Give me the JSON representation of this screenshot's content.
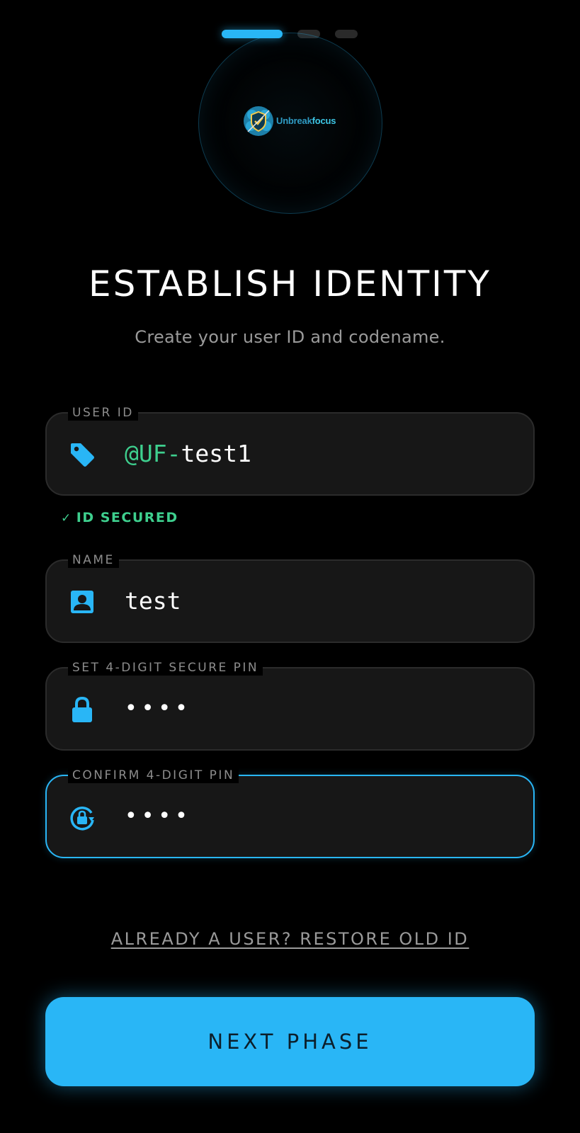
{
  "stepper": {
    "total": 3,
    "current": 1
  },
  "logo": {
    "name_part_a": "Unbreak",
    "name_part_b": "focus"
  },
  "header": {
    "title": "ESTABLISH IDENTITY",
    "subtitle": "Create your user ID and codename."
  },
  "fields": {
    "user_id": {
      "label": "USER ID",
      "prefix": "@UF-",
      "value": "test1",
      "icon": "tag-icon"
    },
    "user_id_status": {
      "text": "ID SECURED",
      "icon": "check-icon"
    },
    "name": {
      "label": "NAME",
      "value": "test",
      "icon": "person-badge-icon"
    },
    "pin": {
      "label": "SET 4-DIGIT SECURE PIN",
      "value": "••••",
      "icon": "lock-icon"
    },
    "confirm_pin": {
      "label": "CONFIRM 4-DIGIT PIN",
      "value": "••••",
      "icon": "lock-reset-icon"
    }
  },
  "restore_link": "ALREADY A USER? RESTORE OLD ID",
  "next_button": "NEXT PHASE",
  "colors": {
    "accent": "#29b6f6",
    "success": "#3ecf8e",
    "background": "#000000",
    "field_background": "#171717"
  }
}
